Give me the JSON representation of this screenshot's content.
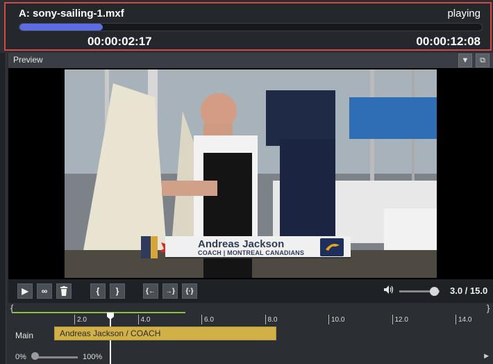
{
  "status": {
    "clip_title": "A: sony-sailing-1.mxf",
    "play_state": "playing",
    "progress_fraction": 0.18,
    "time_current": "00:00:02:17",
    "time_total": "00:00:12:08"
  },
  "preview": {
    "title": "Preview",
    "dropdown_icon": "triangle-down-icon",
    "popout_icon": "popout-icon"
  },
  "overlay": {
    "name": "Andreas Jackson",
    "role": "COACH | MONTREAL CANADIANS",
    "background_sign": "NAVY"
  },
  "controls": {
    "play_icon": "▶",
    "loop_icon": "∞",
    "delete_icon": "🗑",
    "mark_in_icon": "{",
    "mark_out_icon": "}",
    "goto_in_icon": "{←",
    "goto_out_icon": "→}",
    "range_icon": "{·}",
    "volume_icon": "🔊",
    "volume_level": 0.87,
    "speed_display": "3.0 / 15.0"
  },
  "timeline": {
    "ticks": [
      "2.0",
      "4.0",
      "6.0",
      "8.0",
      "10.0",
      "12.0",
      "14.0"
    ],
    "track_label": "Main",
    "clip_label": "Andreas Jackson / COACH",
    "zoom_min": "0%",
    "zoom_max": "100%"
  },
  "colors": {
    "status_border": "#d24a43",
    "progress": "#5f6be0",
    "clip": "#d2b048",
    "range_bar": "#8fc23c"
  }
}
